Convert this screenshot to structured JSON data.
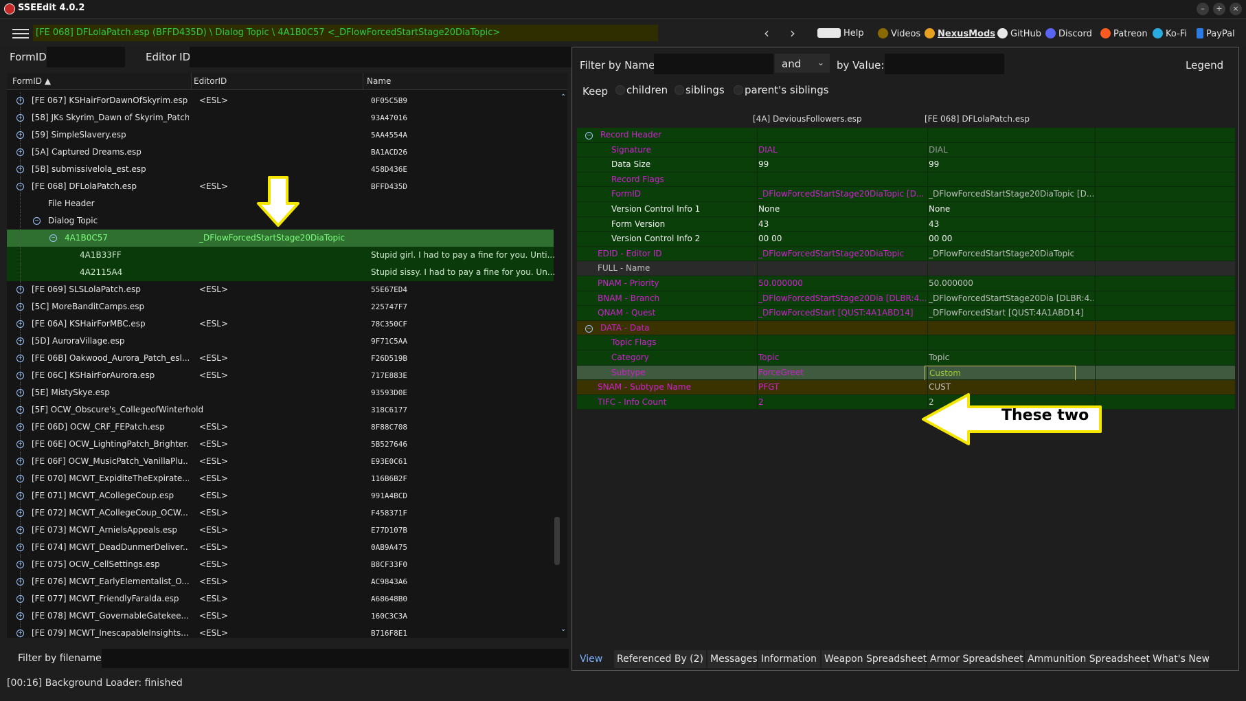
{
  "app": {
    "title": "SSEEdit 4.0.2"
  },
  "toolbar": {
    "path": "[FE 068] DFLolaPatch.esp (BFFD435D) \\ Dialog Topic \\ 4A1B0C57 <_DFlowForcedStartStage20DiaTopic>",
    "links": [
      {
        "label": "Help",
        "icon": "book-icon"
      },
      {
        "label": "Videos",
        "icon": "gear-icon"
      },
      {
        "label": "NexusMods",
        "icon": "nexus-icon"
      },
      {
        "label": "GitHub",
        "icon": "github-icon"
      },
      {
        "label": "Discord",
        "icon": "discord-icon"
      },
      {
        "label": "Patreon",
        "icon": "patreon-icon"
      },
      {
        "label": "Ko-Fi",
        "icon": "kofi-icon"
      },
      {
        "label": "PayPal",
        "icon": "paypal-icon"
      }
    ]
  },
  "left": {
    "formid_label": "FormID",
    "editorid_label": "Editor ID",
    "columns": [
      "FormID",
      "EditorID",
      "Name"
    ],
    "rows": [
      {
        "c1": "[FE 067] KSHairForDawnOfSkyrim.esp",
        "c2": "<ESL>",
        "c3": "0F05C5B9"
      },
      {
        "c1": "[58] JKs Skyrim_Dawn of Skyrim_Patch.esp",
        "c2": "",
        "c3": "93A47016"
      },
      {
        "c1": "[59] SimpleSlavery.esp",
        "c2": "",
        "c3": "5AA4554A"
      },
      {
        "c1": "[5A] Captured Dreams.esp",
        "c2": "",
        "c3": "BA1ACD26"
      },
      {
        "c1": "[5B] submissivelola_est.esp",
        "c2": "",
        "c3": "458D436E"
      },
      {
        "c1": "[FE 068] DFLolaPatch.esp",
        "c2": "<ESL>",
        "c3": "BFFD435D"
      },
      {
        "c1": "File Header",
        "c2": "",
        "c3": ""
      },
      {
        "c1": "Dialog Topic",
        "c2": "",
        "c3": ""
      },
      {
        "c1": "4A1B0C57",
        "c2": "_DFlowForcedStartStage20DiaTopic",
        "c3": ""
      },
      {
        "c1": "4A1B33FF",
        "c2": "",
        "c3": "Stupid girl. I had to pay a fine for you. Unti..."
      },
      {
        "c1": "4A2115A4",
        "c2": "",
        "c3": "Stupid sissy. I had to pay a fine for you. Un..."
      },
      {
        "c1": "[FE 069] SLSLolaPatch.esp",
        "c2": "<ESL>",
        "c3": "55E67ED4"
      },
      {
        "c1": "[5C] MoreBanditCamps.esp",
        "c2": "",
        "c3": "225747F7"
      },
      {
        "c1": "[FE 06A] KSHairForMBC.esp",
        "c2": "<ESL>",
        "c3": "78C350CF"
      },
      {
        "c1": "[5D] AuroraVillage.esp",
        "c2": "",
        "c3": "9F71C5AA"
      },
      {
        "c1": "[FE 06B] Oakwood_Aurora_Patch_esl...",
        "c2": "<ESL>",
        "c3": "F26D519B"
      },
      {
        "c1": "[FE 06C] KSHairForAurora.esp",
        "c2": "<ESL>",
        "c3": "717E883E"
      },
      {
        "c1": "[5E] MistySkye.esp",
        "c2": "",
        "c3": "93593D0E"
      },
      {
        "c1": "[5F] OCW_Obscure's_CollegeofWinterhold.esp",
        "c2": "",
        "c3": "318C6177"
      },
      {
        "c1": "[FE 06D] OCW_CRF_FEPatch.esp",
        "c2": "<ESL>",
        "c3": "8F88C708"
      },
      {
        "c1": "[FE 06E] OCW_LightingPatch_Brighter...",
        "c2": "<ESL>",
        "c3": "5B527646"
      },
      {
        "c1": "[FE 06F] OCW_MusicPatch_VanillaPlu...",
        "c2": "<ESL>",
        "c3": "E93E0C61"
      },
      {
        "c1": "[FE 070] MCWT_ExpiditeTheExpirate....",
        "c2": "<ESL>",
        "c3": "116B6B2F"
      },
      {
        "c1": "[FE 071] MCWT_ACollegeCoup.esp",
        "c2": "<ESL>",
        "c3": "991A4BCD"
      },
      {
        "c1": "[FE 072] MCWT_ACollegeCoup_OCW...",
        "c2": "<ESL>",
        "c3": "F458371F"
      },
      {
        "c1": "[FE 073] MCWT_ArnielsAppeals.esp",
        "c2": "<ESL>",
        "c3": "E77D107B"
      },
      {
        "c1": "[FE 074] MCWT_DeadDunmerDeliver...",
        "c2": "<ESL>",
        "c3": "0AB9A475"
      },
      {
        "c1": "[FE 075] OCW_CellSettings.esp",
        "c2": "<ESL>",
        "c3": "B8CF33F0"
      },
      {
        "c1": "[FE 076] MCWT_EarlyElementalist_O...",
        "c2": "<ESL>",
        "c3": "AC9843A6"
      },
      {
        "c1": "[FE 077] MCWT_FriendlyFaralda.esp",
        "c2": "<ESL>",
        "c3": "A68648B0"
      },
      {
        "c1": "[FE 078] MCWT_GovernableGatekee...",
        "c2": "<ESL>",
        "c3": "160C3C3A"
      },
      {
        "c1": "[FE 079] MCWT_InescapableInsights....",
        "c2": "<ESL>",
        "c3": "B716F8E1"
      }
    ],
    "filter_label": "Filter by filename:",
    "status": "[00:16] Background Loader: finished"
  },
  "right": {
    "filter_name_label": "Filter by Name:",
    "and_value": "and",
    "by_value_label": "by Value:",
    "legend": "Legend",
    "keep_label": "Keep",
    "keep_children": "children",
    "keep_siblings": "siblings",
    "keep_parents": "parent's siblings",
    "col1": "[4A] DeviousFollowers.esp",
    "col2": "[FE 068] DFLolaPatch.esp",
    "rows": [
      {
        "l": "Record Header",
        "v1": "",
        "v2": ""
      },
      {
        "l": "Signature",
        "v1": "DIAL",
        "v2": "DIAL"
      },
      {
        "l": "Data Size",
        "v1": "99",
        "v2": "99"
      },
      {
        "l": "Record Flags",
        "v1": "",
        "v2": ""
      },
      {
        "l": "FormID",
        "v1": "_DFlowForcedStartStage20DiaTopic [D...",
        "v2": "_DFlowForcedStartStage20DiaTopic [D..."
      },
      {
        "l": "Version Control Info 1",
        "v1": "None",
        "v2": "None"
      },
      {
        "l": "Form Version",
        "v1": "43",
        "v2": "43"
      },
      {
        "l": "Version Control Info 2",
        "v1": "00 00",
        "v2": "00 00"
      },
      {
        "l": "EDID - Editor ID",
        "v1": "_DFlowForcedStartStage20DiaTopic",
        "v2": "_DFlowForcedStartStage20DiaTopic"
      },
      {
        "l": "FULL - Name",
        "v1": "",
        "v2": ""
      },
      {
        "l": "PNAM - Priority",
        "v1": "50.000000",
        "v2": "50.000000"
      },
      {
        "l": "BNAM - Branch",
        "v1": "_DFlowForcedStartStage20Dia [DLBR:4...",
        "v2": "_DFlowForcedStartStage20Dia [DLBR:4..."
      },
      {
        "l": "QNAM - Quest",
        "v1": "_DFlowForcedStart [QUST:4A1ABD14]",
        "v2": "_DFlowForcedStart [QUST:4A1ABD14]"
      },
      {
        "l": "DATA - Data",
        "v1": "",
        "v2": ""
      },
      {
        "l": "Topic Flags",
        "v1": "",
        "v2": ""
      },
      {
        "l": "Category",
        "v1": "Topic",
        "v2": "Topic"
      },
      {
        "l": "Subtype",
        "v1": "ForceGreet",
        "v2": "Custom"
      },
      {
        "l": "SNAM - Subtype Name",
        "v1": "PFGT",
        "v2": "CUST"
      },
      {
        "l": "TIFC - Info Count",
        "v1": "2",
        "v2": "2"
      }
    ],
    "callout": "These two",
    "tabs": [
      "View",
      "Referenced By (2)",
      "Messages",
      "Information",
      "Weapon Spreadsheet",
      "Armor Spreadsheet",
      "Ammunition Spreadsheet",
      "What's New"
    ]
  }
}
